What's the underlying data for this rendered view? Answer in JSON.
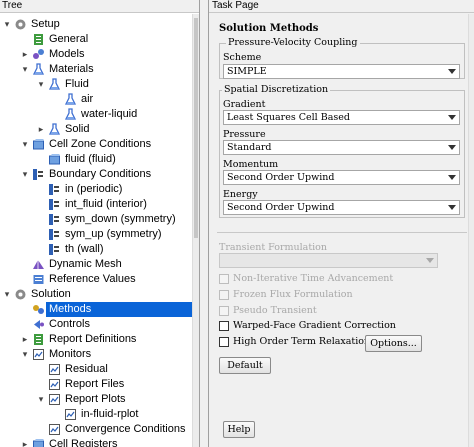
{
  "tree": {
    "header": "Tree",
    "items": [
      {
        "label": "Setup"
      },
      {
        "label": "General"
      },
      {
        "label": "Models"
      },
      {
        "label": "Materials"
      },
      {
        "label": "Fluid"
      },
      {
        "label": "air"
      },
      {
        "label": "water-liquid"
      },
      {
        "label": "Solid"
      },
      {
        "label": "Cell Zone Conditions"
      },
      {
        "label": "fluid (fluid)"
      },
      {
        "label": "Boundary Conditions"
      },
      {
        "label": "in (periodic)"
      },
      {
        "label": "int_fluid (interior)"
      },
      {
        "label": "sym_down (symmetry)"
      },
      {
        "label": "sym_up (symmetry)"
      },
      {
        "label": "th (wall)"
      },
      {
        "label": "Dynamic Mesh"
      },
      {
        "label": "Reference Values"
      },
      {
        "label": "Solution"
      },
      {
        "label": "Methods"
      },
      {
        "label": "Controls"
      },
      {
        "label": "Report Definitions"
      },
      {
        "label": "Monitors"
      },
      {
        "label": "Residual"
      },
      {
        "label": "Report Files"
      },
      {
        "label": "Report Plots"
      },
      {
        "label": "in-fluid-rplot"
      },
      {
        "label": "Convergence Conditions"
      },
      {
        "label": "Cell Registers"
      }
    ]
  },
  "task": {
    "header": "Task Page",
    "title": "Solution Methods",
    "pv_coupling": {
      "legend": "Pressure-Velocity Coupling",
      "scheme_label": "Scheme",
      "scheme_value": "SIMPLE"
    },
    "spatial": {
      "legend": "Spatial Discretization",
      "gradient_label": "Gradient",
      "gradient_value": "Least Squares Cell Based",
      "pressure_label": "Pressure",
      "pressure_value": "Standard",
      "momentum_label": "Momentum",
      "momentum_value": "Second Order Upwind",
      "energy_label": "Energy",
      "energy_value": "Second Order Upwind"
    },
    "transient_label": "Transient Formulation",
    "transient_value": "",
    "options": {
      "non_iterative": "Non-Iterative Time Advancement",
      "frozen_flux": "Frozen Flux Formulation",
      "pseudo_transient": "Pseudo Transient",
      "warped_face": "Warped-Face Gradient Correction",
      "high_order": "High Order Term Relaxation"
    },
    "options_button": "Options...",
    "default_button": "Default",
    "help_button": "Help"
  }
}
